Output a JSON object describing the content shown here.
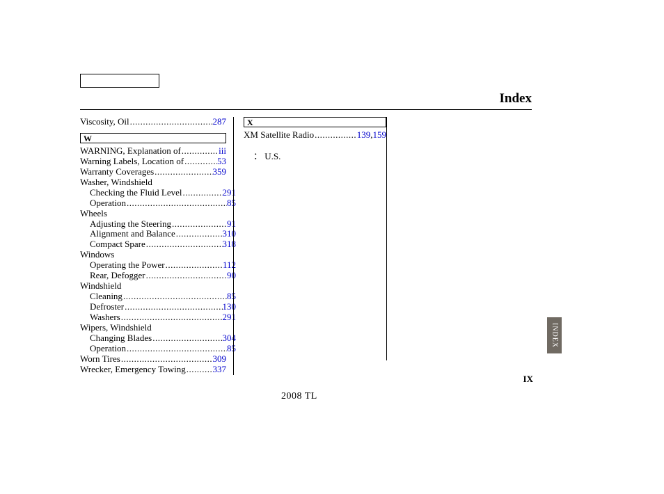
{
  "title": "Index",
  "footer_model": "2008  TL",
  "roman_numeral": "IX",
  "side_tab": "INDEX",
  "viscosity": {
    "label": "Viscosity, Oil",
    "page": "287"
  },
  "W": {
    "letter": "W",
    "warning_expl": {
      "label": "WARNING, Explanation of",
      "page": "iii"
    },
    "warning_labels": {
      "label": "Warning Labels, Location of",
      "page": "53"
    },
    "warranty": {
      "label": "Warranty Coverages",
      "page": "359"
    },
    "washer_windshield": {
      "label": "Washer, Windshield"
    },
    "washer_check": {
      "label": "Checking the Fluid Level",
      "page": "291"
    },
    "washer_operation": {
      "label": "Operation",
      "page": "85"
    },
    "wheels": {
      "label": "Wheels"
    },
    "wheels_adjust": {
      "label": "Adjusting the Steering",
      "page": "91"
    },
    "wheels_align": {
      "label": "Alignment and Balance",
      "page": "310"
    },
    "wheels_spare": {
      "label": "Compact Spare",
      "page": "318"
    },
    "windows": {
      "label": "Windows"
    },
    "windows_power": {
      "label": "Operating the Power",
      "page": "112"
    },
    "windows_defog": {
      "label": "Rear, Defogger",
      "page": "90"
    },
    "windshield": {
      "label": "Windshield"
    },
    "windshield_clean": {
      "label": "Cleaning",
      "page": "85"
    },
    "windshield_defrost": {
      "label": "Defroster",
      "page": "130"
    },
    "windshield_wash": {
      "label": "Washers",
      "page": "291"
    },
    "wipers": {
      "label": "Wipers, Windshield"
    },
    "wipers_blades": {
      "label": "Changing Blades",
      "page": "304"
    },
    "wipers_operation": {
      "label": "Operation",
      "page": "85"
    },
    "worn_tires": {
      "label": "Worn Tires",
      "page": "309"
    },
    "wrecker": {
      "label": "Wrecker, Emergency Towing",
      "page": "337"
    }
  },
  "X": {
    "letter": "X",
    "xm_radio": {
      "label": "XM Satellite Radio",
      "page1": "139",
      "sep": ", ",
      "page2": "159"
    },
    "note_marker": "：",
    "note_body": "U.S."
  }
}
